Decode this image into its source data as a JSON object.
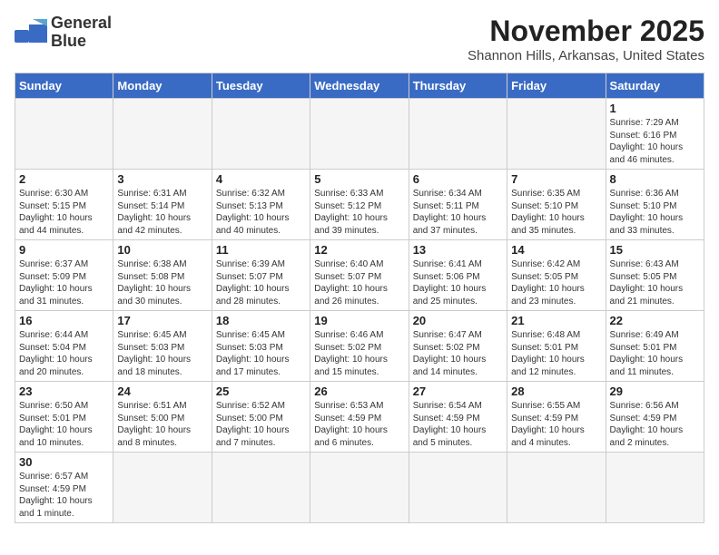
{
  "logo": {
    "line1": "General",
    "line2": "Blue"
  },
  "title": "November 2025",
  "location": "Shannon Hills, Arkansas, United States",
  "days_of_week": [
    "Sunday",
    "Monday",
    "Tuesday",
    "Wednesday",
    "Thursday",
    "Friday",
    "Saturday"
  ],
  "weeks": [
    [
      {
        "day": "",
        "info": ""
      },
      {
        "day": "",
        "info": ""
      },
      {
        "day": "",
        "info": ""
      },
      {
        "day": "",
        "info": ""
      },
      {
        "day": "",
        "info": ""
      },
      {
        "day": "",
        "info": ""
      },
      {
        "day": "1",
        "info": "Sunrise: 7:29 AM\nSunset: 6:16 PM\nDaylight: 10 hours\nand 46 minutes."
      }
    ],
    [
      {
        "day": "2",
        "info": "Sunrise: 6:30 AM\nSunset: 5:15 PM\nDaylight: 10 hours\nand 44 minutes."
      },
      {
        "day": "3",
        "info": "Sunrise: 6:31 AM\nSunset: 5:14 PM\nDaylight: 10 hours\nand 42 minutes."
      },
      {
        "day": "4",
        "info": "Sunrise: 6:32 AM\nSunset: 5:13 PM\nDaylight: 10 hours\nand 40 minutes."
      },
      {
        "day": "5",
        "info": "Sunrise: 6:33 AM\nSunset: 5:12 PM\nDaylight: 10 hours\nand 39 minutes."
      },
      {
        "day": "6",
        "info": "Sunrise: 6:34 AM\nSunset: 5:11 PM\nDaylight: 10 hours\nand 37 minutes."
      },
      {
        "day": "7",
        "info": "Sunrise: 6:35 AM\nSunset: 5:10 PM\nDaylight: 10 hours\nand 35 minutes."
      },
      {
        "day": "8",
        "info": "Sunrise: 6:36 AM\nSunset: 5:10 PM\nDaylight: 10 hours\nand 33 minutes."
      }
    ],
    [
      {
        "day": "9",
        "info": "Sunrise: 6:37 AM\nSunset: 5:09 PM\nDaylight: 10 hours\nand 31 minutes."
      },
      {
        "day": "10",
        "info": "Sunrise: 6:38 AM\nSunset: 5:08 PM\nDaylight: 10 hours\nand 30 minutes."
      },
      {
        "day": "11",
        "info": "Sunrise: 6:39 AM\nSunset: 5:07 PM\nDaylight: 10 hours\nand 28 minutes."
      },
      {
        "day": "12",
        "info": "Sunrise: 6:40 AM\nSunset: 5:07 PM\nDaylight: 10 hours\nand 26 minutes."
      },
      {
        "day": "13",
        "info": "Sunrise: 6:41 AM\nSunset: 5:06 PM\nDaylight: 10 hours\nand 25 minutes."
      },
      {
        "day": "14",
        "info": "Sunrise: 6:42 AM\nSunset: 5:05 PM\nDaylight: 10 hours\nand 23 minutes."
      },
      {
        "day": "15",
        "info": "Sunrise: 6:43 AM\nSunset: 5:05 PM\nDaylight: 10 hours\nand 21 minutes."
      }
    ],
    [
      {
        "day": "16",
        "info": "Sunrise: 6:44 AM\nSunset: 5:04 PM\nDaylight: 10 hours\nand 20 minutes."
      },
      {
        "day": "17",
        "info": "Sunrise: 6:45 AM\nSunset: 5:03 PM\nDaylight: 10 hours\nand 18 minutes."
      },
      {
        "day": "18",
        "info": "Sunrise: 6:45 AM\nSunset: 5:03 PM\nDaylight: 10 hours\nand 17 minutes."
      },
      {
        "day": "19",
        "info": "Sunrise: 6:46 AM\nSunset: 5:02 PM\nDaylight: 10 hours\nand 15 minutes."
      },
      {
        "day": "20",
        "info": "Sunrise: 6:47 AM\nSunset: 5:02 PM\nDaylight: 10 hours\nand 14 minutes."
      },
      {
        "day": "21",
        "info": "Sunrise: 6:48 AM\nSunset: 5:01 PM\nDaylight: 10 hours\nand 12 minutes."
      },
      {
        "day": "22",
        "info": "Sunrise: 6:49 AM\nSunset: 5:01 PM\nDaylight: 10 hours\nand 11 minutes."
      }
    ],
    [
      {
        "day": "23",
        "info": "Sunrise: 6:50 AM\nSunset: 5:01 PM\nDaylight: 10 hours\nand 10 minutes."
      },
      {
        "day": "24",
        "info": "Sunrise: 6:51 AM\nSunset: 5:00 PM\nDaylight: 10 hours\nand 8 minutes."
      },
      {
        "day": "25",
        "info": "Sunrise: 6:52 AM\nSunset: 5:00 PM\nDaylight: 10 hours\nand 7 minutes."
      },
      {
        "day": "26",
        "info": "Sunrise: 6:53 AM\nSunset: 4:59 PM\nDaylight: 10 hours\nand 6 minutes."
      },
      {
        "day": "27",
        "info": "Sunrise: 6:54 AM\nSunset: 4:59 PM\nDaylight: 10 hours\nand 5 minutes."
      },
      {
        "day": "28",
        "info": "Sunrise: 6:55 AM\nSunset: 4:59 PM\nDaylight: 10 hours\nand 4 minutes."
      },
      {
        "day": "29",
        "info": "Sunrise: 6:56 AM\nSunset: 4:59 PM\nDaylight: 10 hours\nand 2 minutes."
      }
    ],
    [
      {
        "day": "30",
        "info": "Sunrise: 6:57 AM\nSunset: 4:59 PM\nDaylight: 10 hours\nand 1 minute."
      },
      {
        "day": "",
        "info": ""
      },
      {
        "day": "",
        "info": ""
      },
      {
        "day": "",
        "info": ""
      },
      {
        "day": "",
        "info": ""
      },
      {
        "day": "",
        "info": ""
      },
      {
        "day": "",
        "info": ""
      }
    ]
  ]
}
